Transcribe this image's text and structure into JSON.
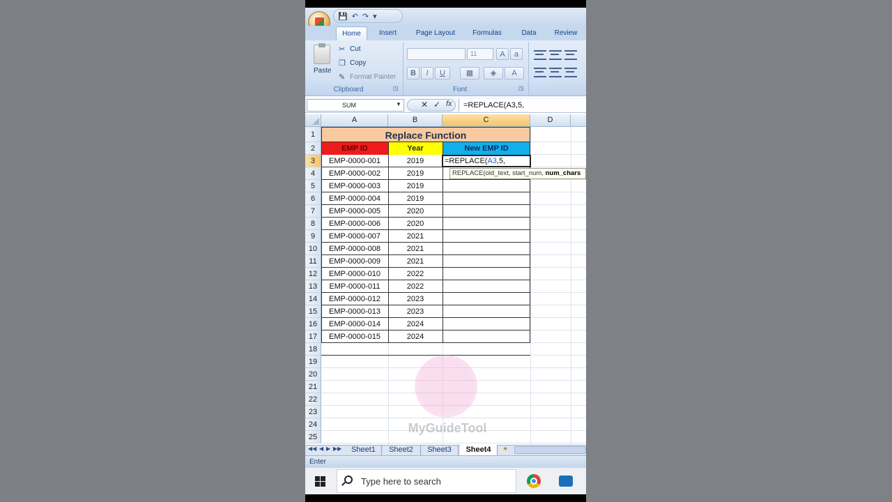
{
  "qat": {
    "save": "💾",
    "undo": "↶",
    "redo": "↷",
    "more": "▾"
  },
  "tabs": [
    "Home",
    "Insert",
    "Page Layout",
    "Formulas",
    "Data",
    "Review"
  ],
  "ribbon": {
    "paste": "Paste",
    "cut": "Cut",
    "copy": "Copy",
    "format_painter": "Format Painter",
    "clipboard_label": "Clipboard",
    "font_label": "Font",
    "font_size": "11",
    "bold": "B",
    "italic": "I",
    "underline": "U"
  },
  "formula_bar": {
    "name_box": "SUM",
    "cancel": "✕",
    "enter": "✓",
    "fx": "fx",
    "formula": "=REPLACE(A3,5,"
  },
  "columns": [
    "A",
    "B",
    "C",
    "D"
  ],
  "rows": [
    "1",
    "2",
    "3",
    "4",
    "5",
    "6",
    "7",
    "8",
    "9",
    "10",
    "11",
    "12",
    "13",
    "14",
    "15",
    "16",
    "17",
    "18",
    "19",
    "20",
    "21",
    "22",
    "23",
    "24",
    "25"
  ],
  "sheet": {
    "title": "Replace Function",
    "headers": [
      "EMP ID",
      "Year",
      "New EMP ID"
    ],
    "data": [
      [
        "EMP-0000-001",
        "2019"
      ],
      [
        "EMP-0000-002",
        "2019"
      ],
      [
        "EMP-0000-003",
        "2019"
      ],
      [
        "EMP-0000-004",
        "2019"
      ],
      [
        "EMP-0000-005",
        "2020"
      ],
      [
        "EMP-0000-006",
        "2020"
      ],
      [
        "EMP-0000-007",
        "2021"
      ],
      [
        "EMP-0000-008",
        "2021"
      ],
      [
        "EMP-0000-009",
        "2021"
      ],
      [
        "EMP-0000-010",
        "2022"
      ],
      [
        "EMP-0000-011",
        "2022"
      ],
      [
        "EMP-0000-012",
        "2023"
      ],
      [
        "EMP-0000-013",
        "2023"
      ],
      [
        "EMP-0000-014",
        "2024"
      ],
      [
        "EMP-0000-015",
        "2024"
      ]
    ],
    "active_cell_prefix": "=REPLACE(",
    "active_cell_ref": "A3",
    "active_cell_suffix": ",5,",
    "tooltip_normal": "REPLACE(old_text, start_num, ",
    "tooltip_bold": "num_chars"
  },
  "watermark": "MyGuideTool",
  "sheet_tabs": [
    "Sheet1",
    "Sheet2",
    "Sheet3",
    "Sheet4"
  ],
  "sheet_nav": [
    "◀◀",
    "◀",
    "▶",
    "▶▶"
  ],
  "status": "Enter",
  "taskbar": {
    "search_placeholder": "Type here to search"
  }
}
